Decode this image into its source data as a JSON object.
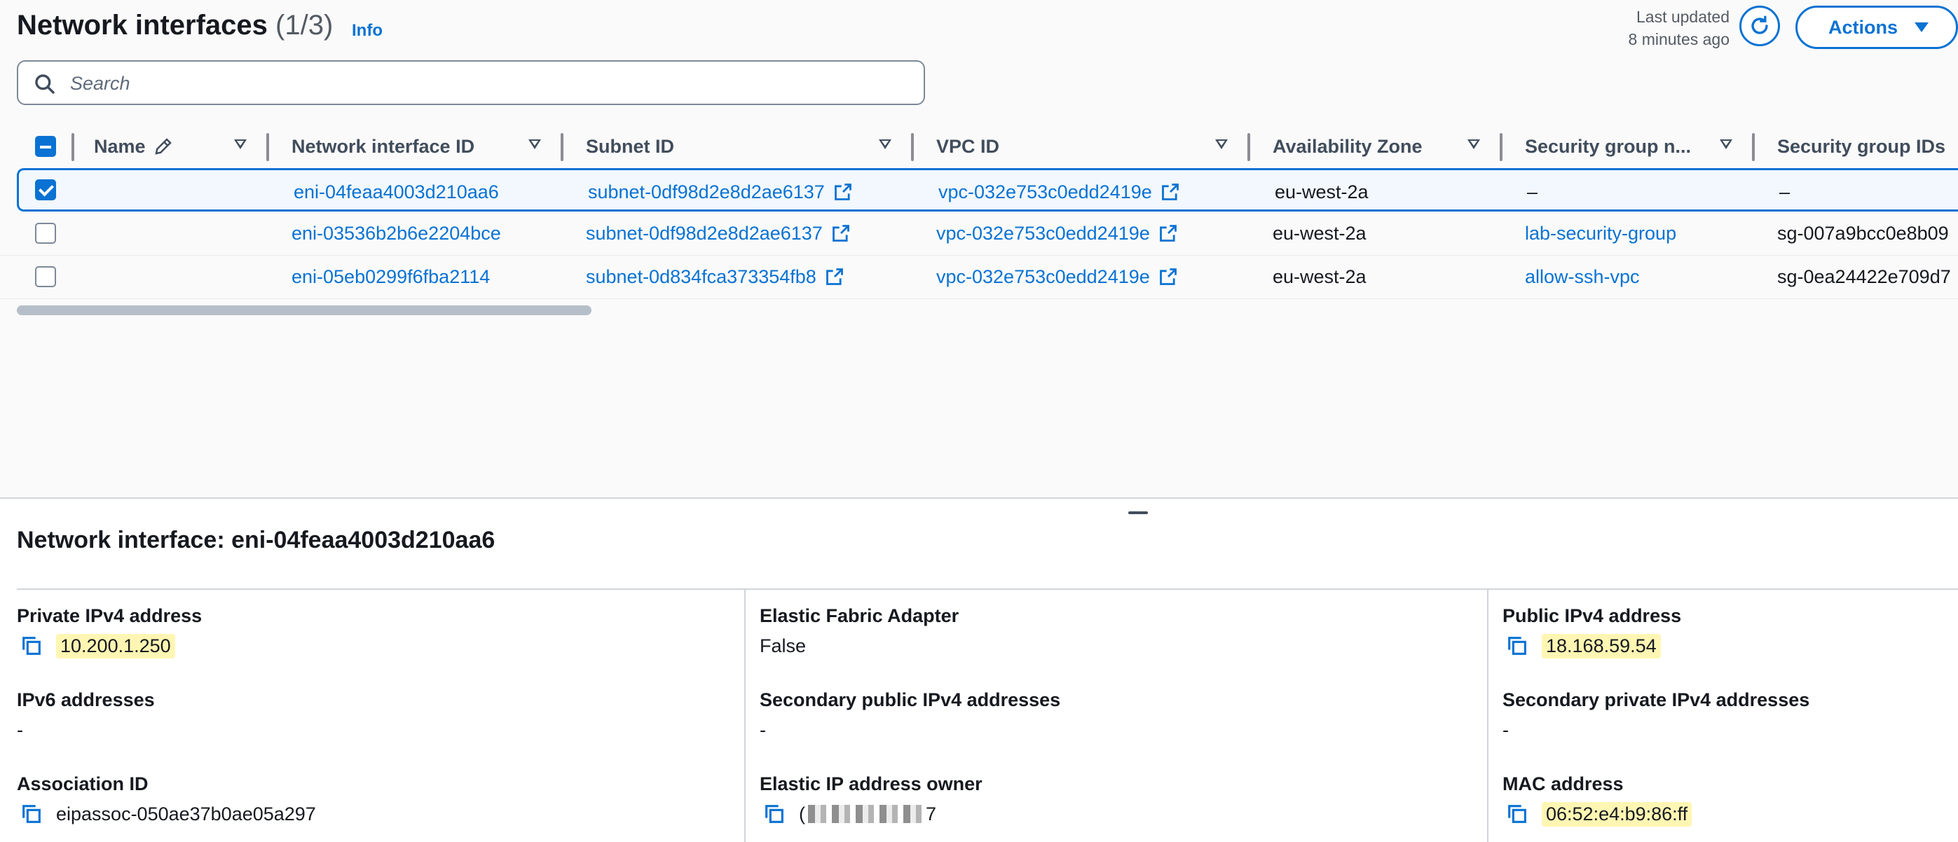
{
  "header": {
    "title": "Network interfaces",
    "count": "(1/3)",
    "info": "Info",
    "last_updated_line1": "Last updated",
    "last_updated_line2": "8 minutes ago",
    "actions_label": "Actions"
  },
  "search": {
    "placeholder": "Search",
    "value": ""
  },
  "table": {
    "columns": [
      "Name",
      "Network interface ID",
      "Subnet ID",
      "VPC ID",
      "Availability Zone",
      "Security group n...",
      "Security group IDs"
    ],
    "rows": [
      {
        "selected": true,
        "name": "",
        "eni_id": "eni-04feaa4003d210aa6",
        "subnet_id": "subnet-0df98d2e8d2ae6137",
        "vpc_id": "vpc-032e753c0edd2419e",
        "az": "eu-west-2a",
        "sg_name": "–",
        "sg_ids": "–"
      },
      {
        "selected": false,
        "name": "",
        "eni_id": "eni-03536b2b6e2204bce",
        "subnet_id": "subnet-0df98d2e8d2ae6137",
        "vpc_id": "vpc-032e753c0edd2419e",
        "az": "eu-west-2a",
        "sg_name": "lab-security-group",
        "sg_ids": "sg-007a9bcc0e8b09"
      },
      {
        "selected": false,
        "name": "",
        "eni_id": "eni-05eb0299f6fba2114",
        "subnet_id": "subnet-0d834fca373354fb8",
        "vpc_id": "vpc-032e753c0edd2419e",
        "az": "eu-west-2a",
        "sg_name": "allow-ssh-vpc",
        "sg_ids": "sg-0ea24422e709d7"
      }
    ]
  },
  "details": {
    "title": "Network interface: eni-04feaa4003d210aa6",
    "col1": {
      "private_ipv4_label": "Private IPv4 address",
      "private_ipv4_value": "10.200.1.250",
      "ipv6_label": "IPv6 addresses",
      "ipv6_value": "-",
      "association_label": "Association ID",
      "association_value": "eipassoc-050ae37b0ae05a297"
    },
    "col2": {
      "efa_label": "Elastic Fabric Adapter",
      "efa_value": "False",
      "secondary_public_label": "Secondary public IPv4 addresses",
      "secondary_public_value": "-",
      "eip_owner_label": "Elastic IP address owner",
      "eip_owner_prefix": "(",
      "eip_owner_suffix": "7"
    },
    "col3": {
      "public_ipv4_label": "Public IPv4 address",
      "public_ipv4_value": "18.168.59.54",
      "secondary_private_label": "Secondary private IPv4 addresses",
      "secondary_private_value": "-",
      "mac_label": "MAC address",
      "mac_value": "06:52:e4:b9:86:ff"
    }
  },
  "colors": {
    "accent": "#0972d3",
    "highlight": "#fff6b3",
    "selected_row_bg": "#f2f8fd"
  },
  "icons": [
    "search-icon",
    "refresh-icon",
    "caret-down-icon",
    "pencil-icon",
    "sort-icon",
    "external-link-icon",
    "copy-icon"
  ]
}
